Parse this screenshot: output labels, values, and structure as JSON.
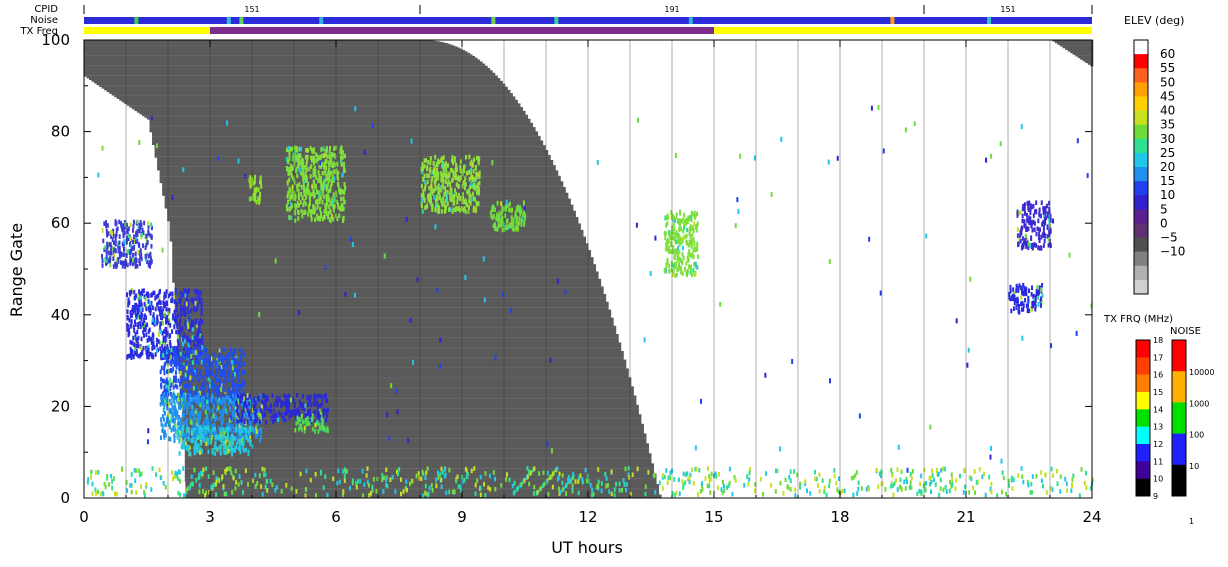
{
  "strip": {
    "cpid_label": "CPID",
    "noise_label": "Noise",
    "txfreq_label": "TX Freq",
    "cpid_segments": [
      {
        "start": 0,
        "end": 8,
        "label": "151"
      },
      {
        "start": 8,
        "end": 20,
        "label": "191"
      },
      {
        "start": 20,
        "end": 24,
        "label": "151"
      }
    ],
    "txfreq_segments": [
      {
        "start": 0,
        "end": 3,
        "color": "#ffff00"
      },
      {
        "start": 3,
        "end": 15,
        "color": "#7b2c8c"
      },
      {
        "start": 15,
        "end": 24,
        "color": "#ffff00"
      }
    ],
    "noise_color": "#2b2bd8"
  },
  "chart_data": {
    "type": "heatmap",
    "xlabel": "UT hours",
    "ylabel": "Range Gate",
    "xlim": [
      0,
      24
    ],
    "ylim": [
      0,
      100
    ],
    "xticks": [
      "0",
      "3",
      "6",
      "9",
      "12",
      "15",
      "18",
      "21",
      "24"
    ],
    "yticks": [
      "0",
      "20",
      "40",
      "60",
      "80",
      "100"
    ],
    "ground_scatter_color": "#5a5a5a",
    "background_color": "#ffffff",
    "clusters": [
      {
        "t0": 0.4,
        "t1": 1.6,
        "g0": 50,
        "g1": 60,
        "color": "#3a3ad6"
      },
      {
        "t0": 1.0,
        "t1": 2.8,
        "g0": 30,
        "g1": 45,
        "color": "#2a2ae0"
      },
      {
        "t0": 1.8,
        "t1": 3.8,
        "g0": 20,
        "g1": 32,
        "color": "#1e4cf0"
      },
      {
        "t0": 1.8,
        "t1": 4.2,
        "g0": 12,
        "g1": 22,
        "color": "#1f8fef"
      },
      {
        "t0": 2.2,
        "t1": 4.0,
        "g0": 9,
        "g1": 15,
        "color": "#21c8e0"
      },
      {
        "t0": 3.6,
        "t1": 5.8,
        "g0": 16,
        "g1": 22,
        "color": "#2828d8"
      },
      {
        "t0": 5.0,
        "t1": 5.8,
        "g0": 14,
        "g1": 17,
        "color": "#4fd64f"
      },
      {
        "t0": 4.8,
        "t1": 6.2,
        "g0": 60,
        "g1": 76,
        "color": "#7fe03a"
      },
      {
        "t0": 3.9,
        "t1": 4.2,
        "g0": 64,
        "g1": 70,
        "color": "#8fe030"
      },
      {
        "t0": 8.0,
        "t1": 9.4,
        "g0": 62,
        "g1": 74,
        "color": "#8ee03a"
      },
      {
        "t0": 9.6,
        "t1": 10.5,
        "g0": 58,
        "g1": 64,
        "color": "#6fdc3c"
      },
      {
        "t0": 13.8,
        "t1": 14.6,
        "g0": 48,
        "g1": 62,
        "color": "#7fe03a"
      },
      {
        "t0": 22.2,
        "t1": 23.0,
        "g0": 54,
        "g1": 64,
        "color": "#3a2ad0"
      },
      {
        "t0": 22.0,
        "t1": 22.8,
        "g0": 40,
        "g1": 46,
        "color": "#2828e0"
      },
      {
        "t0": 0.0,
        "t1": 24.0,
        "g0": 0,
        "g1": 6,
        "color": "#28c8d8"
      }
    ]
  },
  "elev_scale": {
    "title": "ELEV (deg)",
    "labels": [
      "60",
      "55",
      "50",
      "45",
      "40",
      "35",
      "30",
      "25",
      "20",
      "15",
      "10",
      "5",
      "0",
      "−5",
      "−10"
    ],
    "colors": [
      "#ffffff",
      "#ff0000",
      "#ff6020",
      "#ff9f00",
      "#ffd000",
      "#c8e020",
      "#6fdc3c",
      "#2ee090",
      "#20c8e8",
      "#2090f0",
      "#2040f0",
      "#3020d0",
      "#5a2090",
      "#603070",
      "#505050",
      "#808080",
      "#b0b0b0",
      "#d0d0d0"
    ]
  },
  "txfrq_scale": {
    "title": "TX FRQ (MHz)",
    "labels": [
      "18",
      "17",
      "16",
      "15",
      "14",
      "13",
      "12",
      "11",
      "10",
      "9"
    ],
    "colors": [
      "#ff0000",
      "#ff4000",
      "#ff8000",
      "#ffff00",
      "#00e000",
      "#00ffff",
      "#2020ff",
      "#40009a",
      "#000000"
    ]
  },
  "noise_scale": {
    "title": "NOISE",
    "labels": [
      "10000",
      "1000",
      "100",
      "10",
      "1"
    ],
    "colors": [
      "#ff0000",
      "#ffb000",
      "#00e000",
      "#2020ff",
      "#000000"
    ]
  }
}
